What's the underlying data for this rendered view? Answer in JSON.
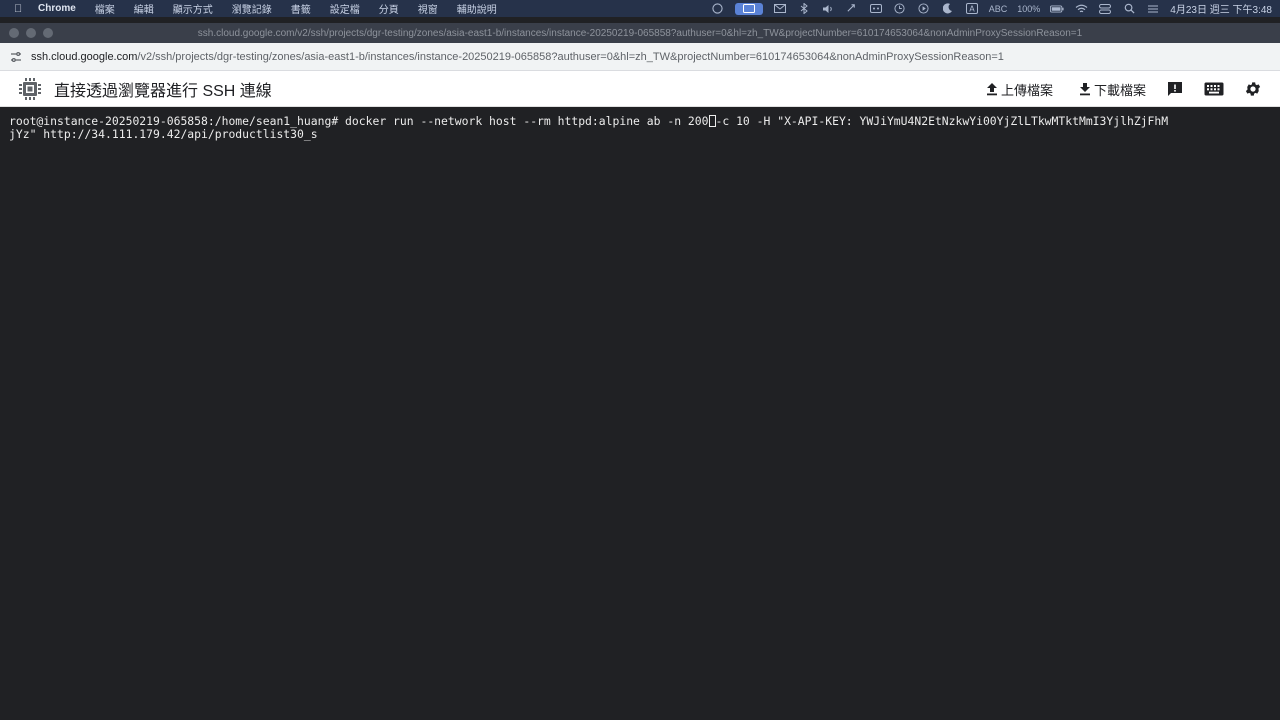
{
  "menubar": {
    "app": "Chrome",
    "items": [
      "檔案",
      "編輯",
      "顯示方式",
      "瀏覽記錄",
      "書籤",
      "設定檔",
      "分頁",
      "視窗",
      "輔助說明"
    ],
    "status_abc": "ABC",
    "status_battery": "100%",
    "clock": "4月23日 週三 下午3:48"
  },
  "window": {
    "title": "ssh.cloud.google.com/v2/ssh/projects/dgr-testing/zones/asia-east1-b/instances/instance-20250219-065858?authuser=0&hl=zh_TW&projectNumber=610174653064&nonAdminProxySessionReason=1"
  },
  "urlbar": {
    "host": "ssh.cloud.google.com",
    "path": "/v2/ssh/projects/dgr-testing/zones/asia-east1-b/instances/instance-20250219-065858?authuser=0&hl=zh_TW&projectNumber=610174653064&nonAdminProxySessionReason=1"
  },
  "ssh": {
    "title": "直接透過瀏覽器進行 SSH 連線",
    "upload_label": "上傳檔案",
    "download_label": "下載檔案"
  },
  "terminal": {
    "line1_before_cursor": "root@instance-20250219-065858:/home/sean1_huang# docker run --network host --rm httpd:alpine ab -n 200",
    "line1_after_cursor": "-c 10 -H \"X-API-KEY: YWJiYmU4N2EtNzkwYi00YjZlLTkwMTktMmI3YjlhZjFhM",
    "line2": "jYz\" http://34.111.179.42/api/productlist30_s"
  },
  "colors": {
    "menubar_bg": "#26324a",
    "terminal_bg": "#202124",
    "terminal_fg": "#ececec",
    "ssh_header_bg": "#ffffff"
  }
}
